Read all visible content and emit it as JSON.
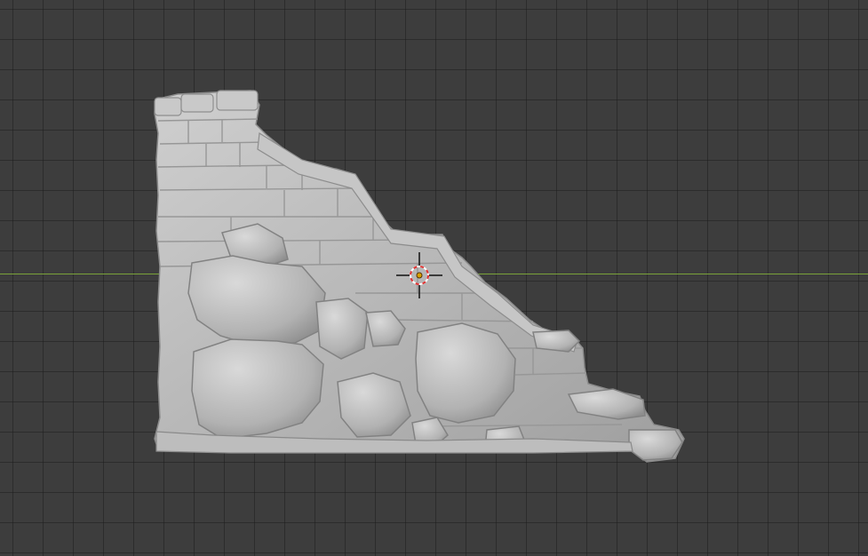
{
  "viewport": {
    "background": "#3d3d3d",
    "grid_line_color": "#2f2f2f",
    "x_axis_color": "#7aa33a"
  },
  "model": {
    "object": "ruined-stone-wall-mesh",
    "base_color": "#b4b4b4",
    "highlight_color": "#d2d2d2",
    "shadow_color": "#8a8a8a"
  },
  "cursor": {
    "ring_red": "#e03030",
    "ring_white": "#ffffff",
    "center_color": "#d8a000",
    "crosshair_color": "#111111"
  }
}
